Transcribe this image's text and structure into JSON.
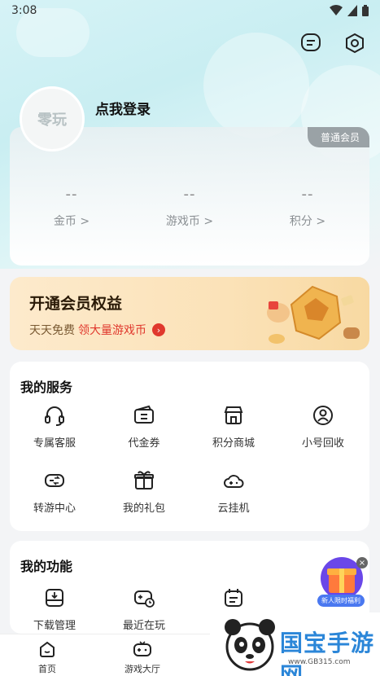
{
  "status_bar": {
    "time": "3:08"
  },
  "profile": {
    "avatar_text": "零玩",
    "login_text": "点我登录",
    "member_badge": "普通会员"
  },
  "stats": [
    {
      "value": "--",
      "label": "金币 >"
    },
    {
      "value": "--",
      "label": "游戏币 >"
    },
    {
      "value": "--",
      "label": "积分 >"
    }
  ],
  "vip_banner": {
    "title": "开通会员权益",
    "sub_prefix": "天天免费",
    "sub_highlight": "领大量游戏币"
  },
  "services": {
    "title": "我的服务",
    "items": [
      {
        "label": "专属客服",
        "icon": "headset-icon"
      },
      {
        "label": "代金券",
        "icon": "voucher-icon"
      },
      {
        "label": "积分商城",
        "icon": "store-icon"
      },
      {
        "label": "小号回收",
        "icon": "account-recycle-icon"
      },
      {
        "label": "转游中心",
        "icon": "gamepad-icon"
      },
      {
        "label": "我的礼包",
        "icon": "gift-icon"
      },
      {
        "label": "云挂机",
        "icon": "cloud-gamepad-icon"
      }
    ]
  },
  "functions": {
    "title": "我的功能",
    "items": [
      {
        "label": "下载管理",
        "icon": "download-tray-icon"
      },
      {
        "label": "最近在玩",
        "icon": "recent-play-icon"
      },
      {
        "label": "",
        "icon": "calendar-icon"
      }
    ]
  },
  "float_promo": {
    "label": "新人限时福利"
  },
  "tabs": [
    {
      "label": "首页",
      "icon": "home-icon"
    },
    {
      "label": "游戏大厅",
      "icon": "game-hall-icon"
    }
  ],
  "watermark": {
    "brand": "国宝手游网",
    "url": "www.GB315.com"
  }
}
